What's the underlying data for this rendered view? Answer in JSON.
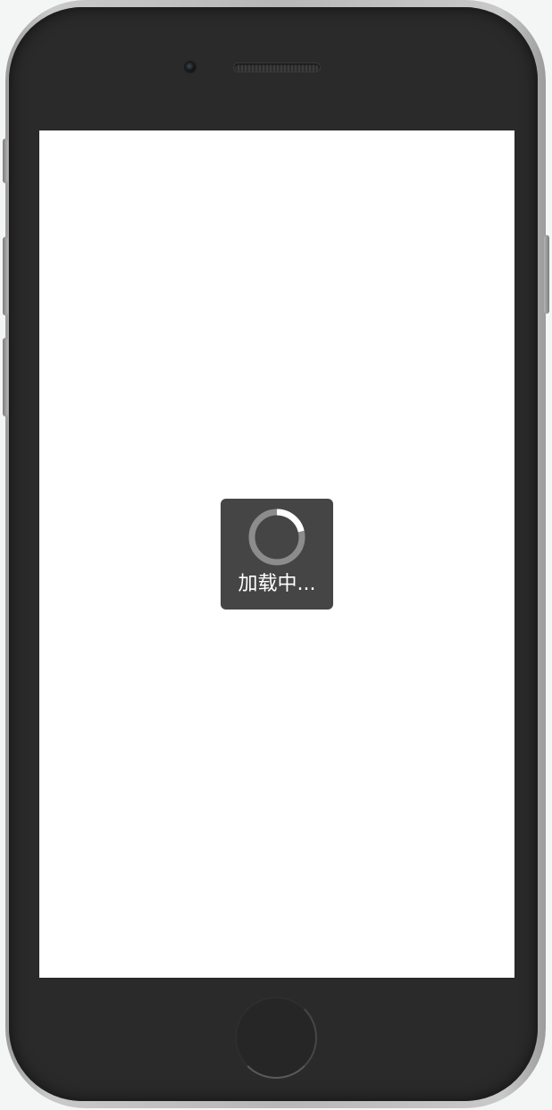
{
  "loading_toast": {
    "label": "加载中...",
    "background_color": "#454545",
    "spinner_track_color": "#8c8c8c",
    "spinner_arc_color": "#ffffff"
  },
  "screen": {
    "background_color": "#ffffff"
  }
}
